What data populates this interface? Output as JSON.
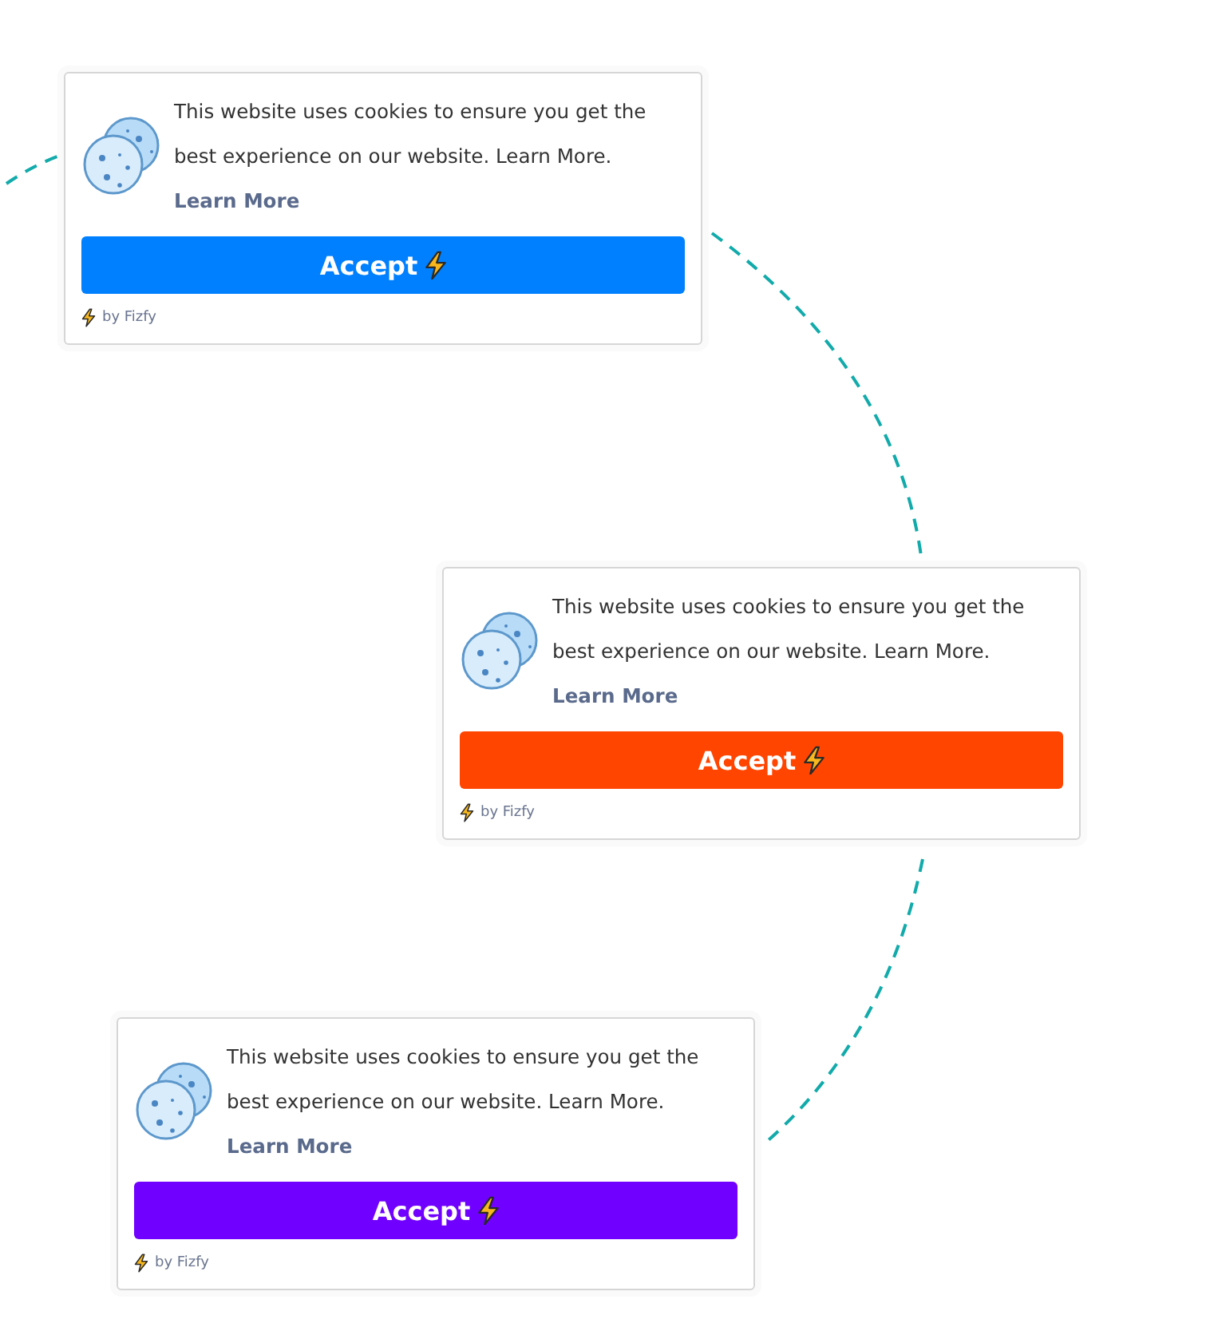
{
  "cards": [
    {
      "message": "This website uses cookies to ensure you get the best experience on our website. Learn More.",
      "link": "Learn More",
      "button": "Accept",
      "color": "#0080ff",
      "credit": "by Fizfy"
    },
    {
      "message": "This website uses cookies to ensure you get the best experience on our website. Learn More.",
      "link": "Learn More",
      "button": "Accept",
      "color": "#ff4500",
      "credit": "by Fizfy"
    },
    {
      "message": "This website uses cookies to ensure you get the best experience on our website. Learn More.",
      "link": "Learn More",
      "button": "Accept",
      "color": "#7000ff",
      "credit": "by Fizfy"
    }
  ]
}
